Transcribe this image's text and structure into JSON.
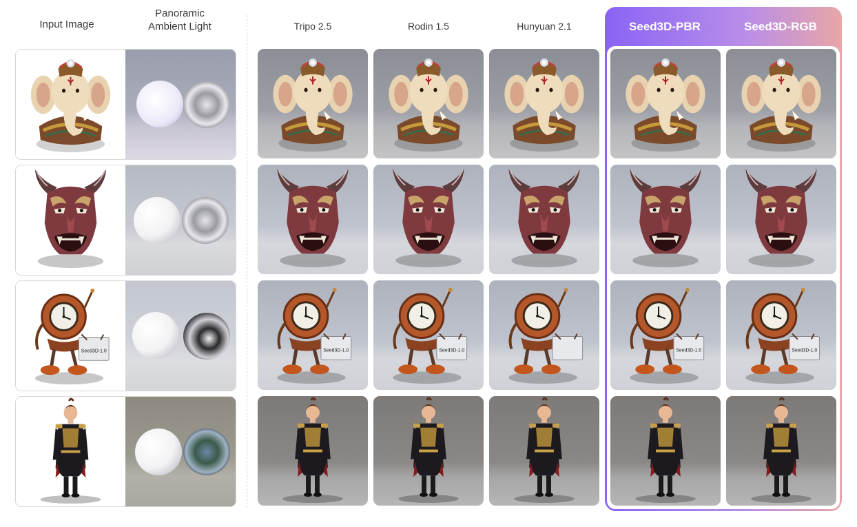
{
  "headers": {
    "input_image": "Input Image",
    "panoramic": "Panoramic\nAmbient Light",
    "methods": [
      "Tripo 2.5",
      "Rodin 1.5",
      "Hunyuan 2.1"
    ],
    "seed": [
      "Seed3D-PBR",
      "Seed3D-RGB"
    ]
  },
  "rows": [
    "ganesha",
    "oni-mask",
    "clock-robot",
    "uniform-boy"
  ],
  "sign_text": "Seed3D-1.0",
  "colors": {
    "seed_gradient_start": "#8a63f5",
    "seed_gradient_end": "#e8a6a6",
    "header_text": "#3a3a3a"
  }
}
